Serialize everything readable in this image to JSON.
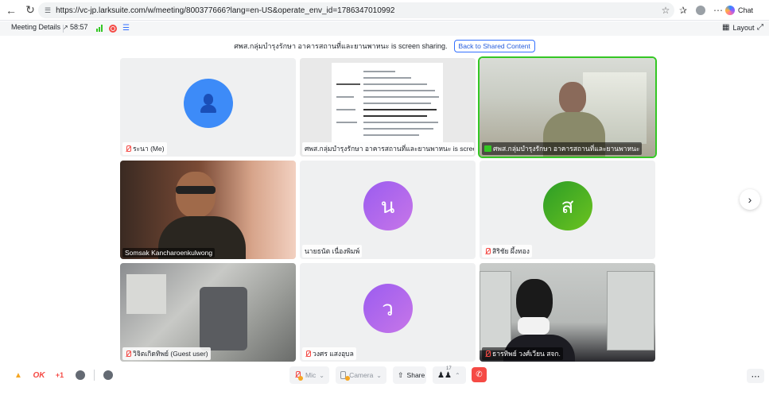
{
  "browser": {
    "url": "https://vc-jp.larksuite.com/w/meeting/800377666?lang=en-US&operate_env_id=1786347010992",
    "chat_label": "Chat"
  },
  "meeting_bar": {
    "details_label": "Meeting Details",
    "timer": "58:57",
    "layout_label": "Layout"
  },
  "share_banner": {
    "text": "ศพส.กลุ่มบำรุงรักษา อาคารสถานที่และยานพาหนะ is screen sharing.",
    "back_label": "Back to Shared Content"
  },
  "tiles": [
    {
      "name": "ระนา (Me)",
      "muted": true,
      "avatar_letter": "",
      "kind": "avatar-blue"
    },
    {
      "name": "ศพส.กลุ่มบำรุงรักษา อาคารสถานที่และยานพาหนะ is screen sharing.",
      "muted": false,
      "kind": "screen-share"
    },
    {
      "name": "ศพส.กลุ่มบำรุงรักษา อาคารสถานที่และยานพาหนะ",
      "muted": false,
      "kind": "video-office",
      "active": true
    },
    {
      "name": "Somsak Kancharoenkulwong",
      "muted": false,
      "kind": "video-man"
    },
    {
      "name": "นายธนัต เนื่องพิมพ์",
      "muted": false,
      "avatar_letter": "น",
      "kind": "avatar-purple"
    },
    {
      "name": "สิริชัย ผึ้งทอง",
      "muted": true,
      "avatar_letter": "ส",
      "kind": "avatar-green"
    },
    {
      "name": "วิจิตเกิดทิพย์ (Guest user)",
      "muted": true,
      "kind": "video-room"
    },
    {
      "name": "วงศร แสงอุบล",
      "muted": true,
      "avatar_letter": "ว",
      "kind": "avatar-purple"
    },
    {
      "name": "ธารทิพย์ วงศ์เวียน สจก.",
      "muted": true,
      "kind": "video-phone"
    }
  ],
  "toolbar": {
    "ok_label": "OK",
    "plus_one_label": "+1",
    "mic_label": "Mic",
    "camera_label": "Camera",
    "share_label": "Share",
    "participants_count": "17"
  }
}
